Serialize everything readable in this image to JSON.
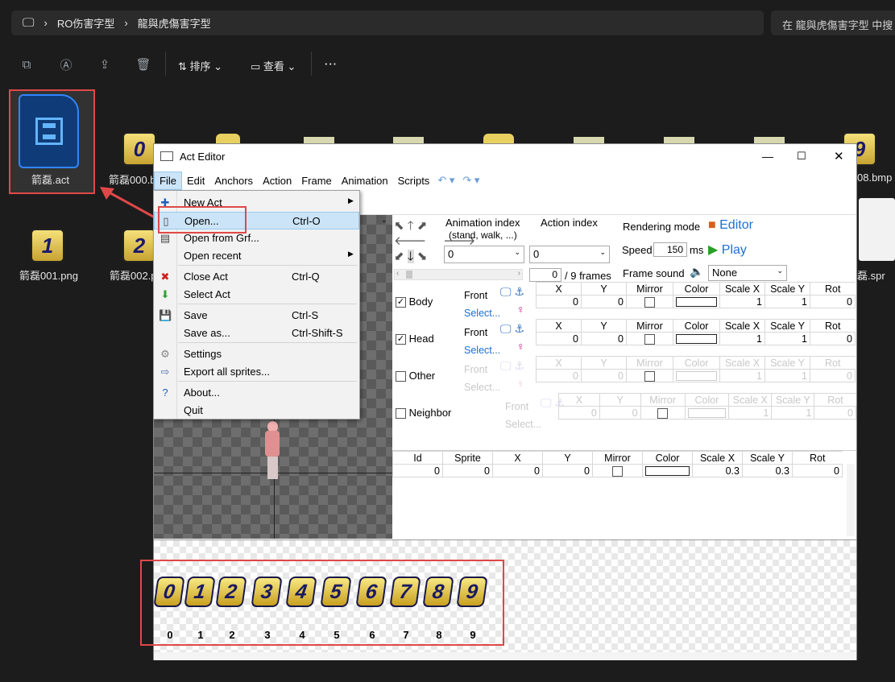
{
  "explorer": {
    "breadcrumb": [
      "RO伤害字型",
      "龍與虎傷害字型"
    ],
    "search_placeholder": "在 龍與虎傷害字型 中搜",
    "toolbar": {
      "sort_label": "排序",
      "view_label": "查看"
    },
    "files": [
      {
        "name": "箭磊.act",
        "icon": "video-file-icon"
      },
      {
        "name": "箭磊000.b",
        "glyph": "0"
      },
      {
        "name": "箭磊001.png",
        "glyph": "1"
      },
      {
        "name": "箭磊002.p",
        "glyph": "2"
      },
      {
        "name": "08.bmp",
        "glyph": "9"
      },
      {
        "name": "磊.spr",
        "icon": "file-icon"
      }
    ]
  },
  "editor": {
    "title": "Act Editor",
    "menu": [
      "File",
      "Edit",
      "Anchors",
      "Action",
      "Frame",
      "Animation",
      "Scripts"
    ],
    "file_menu": [
      {
        "label": "New Act",
        "shortcut": "",
        "submenu": true
      },
      {
        "label": "Open...",
        "shortcut": "Ctrl-O"
      },
      {
        "label": "Open from Grf...",
        "shortcut": ""
      },
      {
        "label": "Open recent",
        "shortcut": "",
        "submenu": true
      },
      {
        "label": "Close Act",
        "shortcut": "Ctrl-Q"
      },
      {
        "label": "Select Act",
        "shortcut": ""
      },
      {
        "label": "Save",
        "shortcut": "Ctrl-S"
      },
      {
        "label": "Save as...",
        "shortcut": "Ctrl-Shift-S"
      },
      {
        "label": "Settings",
        "shortcut": ""
      },
      {
        "label": "Export all sprites...",
        "shortcut": ""
      },
      {
        "label": "About...",
        "shortcut": ""
      },
      {
        "label": "Quit",
        "shortcut": ""
      }
    ],
    "animation_index_label": "Animation index",
    "animation_index_sub": "(stand, walk, ...)",
    "action_index_label": "Action index",
    "animation_index_value": "0",
    "action_index_value": "0",
    "frame_value": "0",
    "frames_total": "/ 9 frames",
    "rendering_mode_label": "Rendering mode",
    "rendering_mode_value": "Editor",
    "speed_label": "Speed",
    "speed_value": "150",
    "speed_unit": "ms",
    "play_label": "Play",
    "frame_sound_label": "Frame sound",
    "frame_sound_value": "None",
    "layer_columns": [
      "X",
      "Y",
      "Mirror",
      "Color",
      "Scale X",
      "Scale Y",
      "Rot"
    ],
    "layers": [
      {
        "name": "Body",
        "checked": true,
        "front": "Front",
        "select": "Select...",
        "values": [
          "0",
          "0",
          "",
          "",
          "1",
          "1",
          "0"
        ]
      },
      {
        "name": "Head",
        "checked": true,
        "front": "Front",
        "select": "Select...",
        "values": [
          "0",
          "0",
          "",
          "",
          "1",
          "1",
          "0"
        ]
      },
      {
        "name": "Other",
        "checked": false,
        "front": "Front",
        "select": "Select...",
        "values": [
          "0",
          "0",
          "",
          "",
          "1",
          "1",
          "0"
        ]
      },
      {
        "name": "Neighbor",
        "checked": false,
        "front": "Front",
        "select": "Select...",
        "values": [
          "0",
          "0",
          "",
          "",
          "1",
          "1",
          "0"
        ]
      }
    ],
    "sprite_columns": [
      "Id",
      "Sprite",
      "X",
      "Y",
      "Mirror",
      "Color",
      "Scale X",
      "Scale Y",
      "Rot"
    ],
    "sprite_rows": [
      {
        "id": "0",
        "sprite": "0",
        "x": "0",
        "y": "0",
        "mirror": "",
        "color": "",
        "scale_x": "0.3",
        "scale_y": "0.3",
        "rot": "0"
      }
    ],
    "sprite_strip": [
      "0",
      "1",
      "2",
      "3",
      "4",
      "5",
      "6",
      "7",
      "8",
      "9"
    ]
  }
}
